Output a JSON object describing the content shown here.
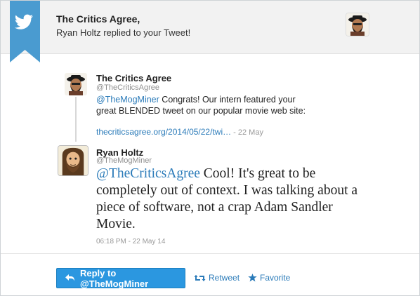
{
  "header": {
    "title": "The Critics Agree,",
    "subtitle": "Ryan Holtz replied to your Tweet!"
  },
  "original_tweet": {
    "name": "The Critics Agree",
    "handle": "@TheCriticsAgree",
    "mention": "@TheMogMiner",
    "text": " Congrats! Our intern featured your great BLENDED tweet on our popular movie web site:",
    "link": "thecriticsagree.org/2014/05/22/twi…",
    "time": " - 22 May"
  },
  "reply_tweet": {
    "name": "Ryan Holtz",
    "handle": "@TheMogMiner",
    "mention": "@TheCriticsAgree",
    "text": " Cool! It's great to be completely out of context. I was talking about a piece of software, not a crap Adam Sandler Movie.",
    "timestamp": "06:18 PM - 22 May 14"
  },
  "actions": {
    "reply_label": "Reply to @TheMogMiner",
    "retweet_label": "Retweet",
    "favorite_label": "Favorite"
  },
  "icons": {
    "brand": "twitter-bird-icon",
    "reply": "reply-arrow-icon",
    "retweet": "retweet-icon",
    "favorite": "star-icon"
  },
  "colors": {
    "brand_blue": "#2b7bb9",
    "ribbon": "#4a9bd0",
    "button": "#2b97e0"
  }
}
